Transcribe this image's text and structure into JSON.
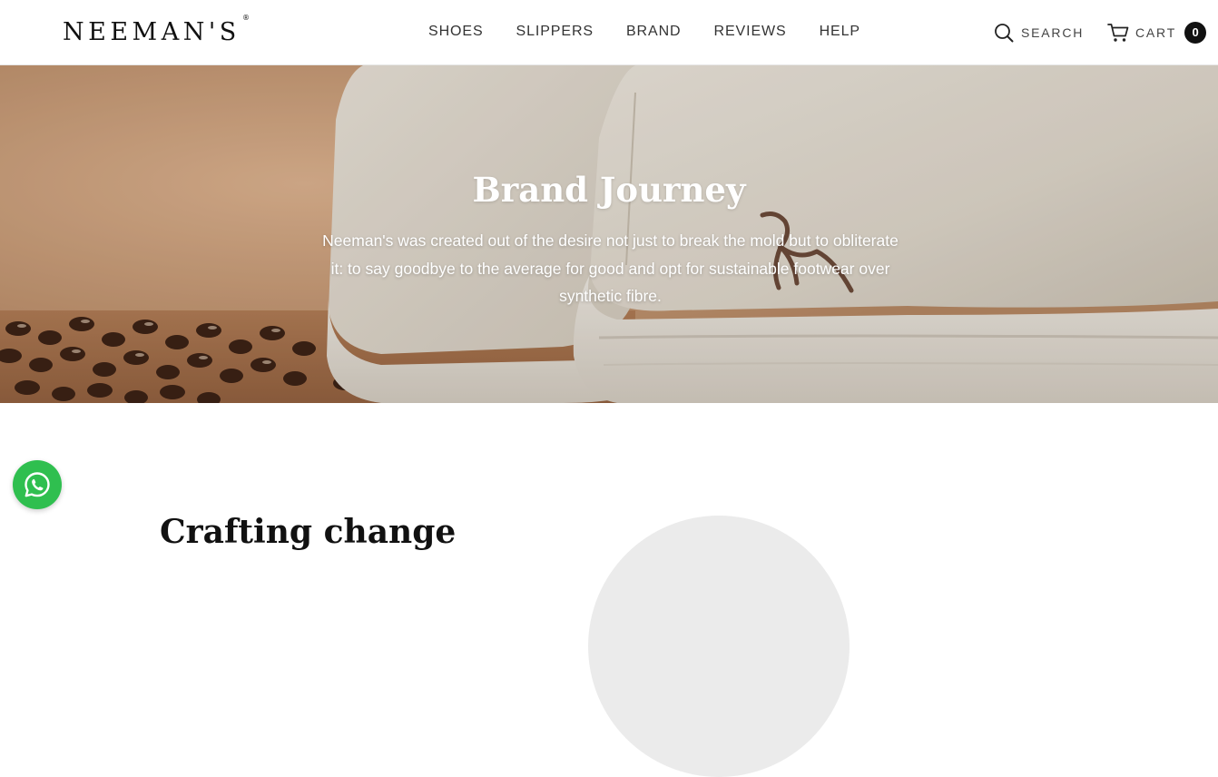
{
  "header": {
    "logo_text": "NEEMAN'S",
    "logo_mark": "®",
    "nav": [
      "SHOES",
      "SLIPPERS",
      "BRAND",
      "REVIEWS",
      "HELP"
    ],
    "search_label": "SEARCH",
    "search_icon": "search-icon",
    "cart_label": "CART",
    "cart_icon": "cart-icon",
    "cart_count": "0"
  },
  "hero": {
    "title": "Brand Journey",
    "text": "Neeman's was created out of the desire not just to break the mold but to obliterate it: to say goodbye to the average for good and opt for sustainable footwear over synthetic fibre."
  },
  "section": {
    "title": "Crafting change"
  },
  "floating": {
    "whatsapp_icon": "whatsapp-icon"
  },
  "colors": {
    "brand_dark": "#111111",
    "whatsapp_green": "#2fbf4f",
    "hero_tan": "#c79770",
    "wool_cream": "#e4dfd3"
  }
}
